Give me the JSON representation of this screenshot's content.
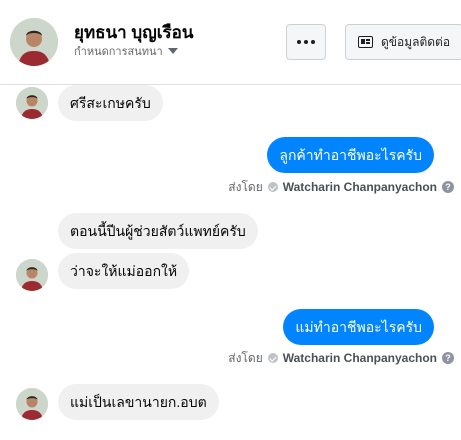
{
  "header": {
    "contact_name": "ยุทธนา บุญเรือน",
    "conversation_settings_label": "กำหนดการสนทนา",
    "more_icon": "more-dots-icon",
    "view_contact_label": "ดูข้อมูลติดต่อ"
  },
  "messages": [
    {
      "direction": "incoming",
      "text": "ศรีสะเกษครับ",
      "avatar": true
    },
    {
      "direction": "outgoing",
      "text": "ลูกค้าทำอาชีพอะไรครับ"
    },
    {
      "direction": "incoming",
      "text": "ตอนนี้ปีนผู้ช่วยสัตว์แพทย์ครับ",
      "avatar": false
    },
    {
      "direction": "incoming",
      "text": "ว่าจะให้แม่ออกให้",
      "avatar": true
    },
    {
      "direction": "outgoing",
      "text": "แม่ทำอาชีพอะไรครับ"
    },
    {
      "direction": "incoming",
      "text": "แม่เป็นเลขานายก.อบต",
      "avatar": true
    }
  ],
  "sent_by": [
    {
      "label": "ส่งโดย",
      "name": "Watcharin Chanpanyachon",
      "help": "?"
    },
    {
      "label": "ส่งโดย",
      "name": "Watcharin Chanpanyachon",
      "help": "?"
    }
  ],
  "colors": {
    "outgoing_bubble": "#0084ff",
    "incoming_bubble": "#f0f0f0",
    "header_border": "#dddfe2"
  }
}
